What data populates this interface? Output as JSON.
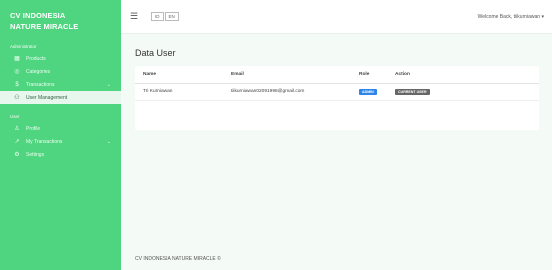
{
  "brand": {
    "line1": "CV INDONESIA",
    "line2": "NATURE MIRACLE"
  },
  "sidebar": {
    "admin_section": "Administrator",
    "admin_items": [
      {
        "label": "Products",
        "icon": "box-icon"
      },
      {
        "label": "Categories",
        "icon": "tag-icon"
      },
      {
        "label": "Transactions",
        "icon": "dollar-icon"
      },
      {
        "label": "User Management",
        "icon": "users-icon"
      }
    ],
    "user_section": "User",
    "user_items": [
      {
        "label": "Profile",
        "icon": "person-icon"
      },
      {
        "label": "My Transactions",
        "icon": "chart-icon"
      },
      {
        "label": "Settings",
        "icon": "gear-icon"
      }
    ]
  },
  "topbar": {
    "lang_options": [
      "ID",
      "EN"
    ],
    "welcome": "Welcome Back, tiikurniawan ▾"
  },
  "main": {
    "title": "Data User",
    "columns": [
      "Name",
      "Email",
      "Role",
      "Action"
    ],
    "rows": [
      {
        "name": "Tri Kurniawan",
        "email": "tiikurniawan02091998@gmail.com",
        "role": "ADMIN",
        "action": "CURRENT USER"
      }
    ]
  },
  "footer": {
    "text": "CV INDONESIA NATURE MIRACLE ©"
  },
  "colors": {
    "sidebar": "#4fd47f",
    "role_badge": "#2f86e8",
    "action_badge": "#666666",
    "background": "#f4fbf6"
  }
}
